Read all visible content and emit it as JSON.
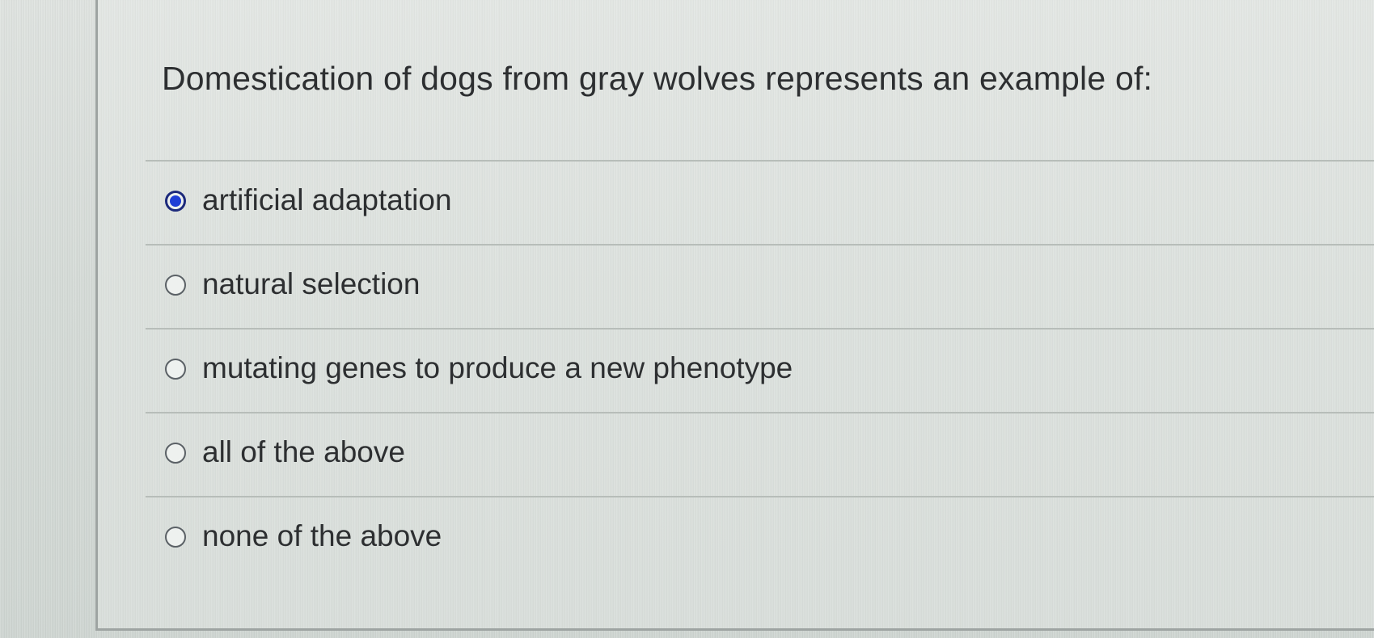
{
  "question": {
    "text": "Domestication of dogs from gray wolves represents an example of:"
  },
  "answers": [
    {
      "label": "artificial adaptation",
      "selected": true
    },
    {
      "label": "natural selection",
      "selected": false
    },
    {
      "label": "mutating genes to produce a new phenotype",
      "selected": false
    },
    {
      "label": "all of the above",
      "selected": false
    },
    {
      "label": "none of the above",
      "selected": false
    }
  ],
  "colors": {
    "selected_radio": "#1f3ed6",
    "text": "#2d2f31"
  }
}
